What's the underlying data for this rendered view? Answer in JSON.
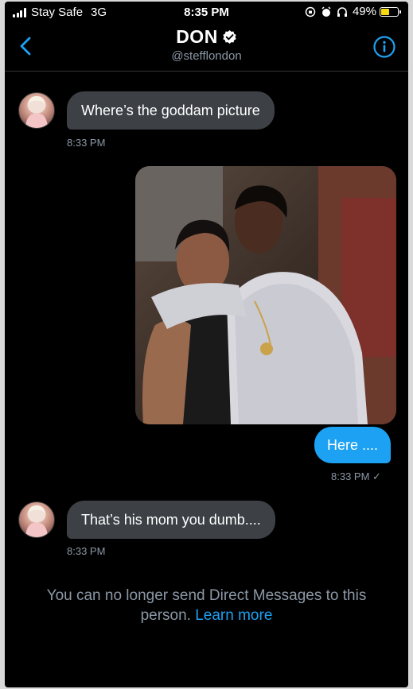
{
  "status_bar": {
    "carrier": "Stay Safe",
    "network": "3G",
    "time": "8:35 PM",
    "battery": "49%",
    "battery_level": 0.49,
    "battery_color": "#f5d90a"
  },
  "header": {
    "title": "DON",
    "handle": "@stefflondon",
    "back_icon": "chevron-left-icon",
    "info_icon": "info-circle-icon",
    "verified_icon": "verified-badge-icon"
  },
  "messages": [
    {
      "direction": "incoming",
      "text": "Where’s the goddam picture",
      "time": "8:33 PM"
    },
    {
      "direction": "outgoing",
      "type": "image",
      "text": "Here ....",
      "time": "8:33 PM ✓"
    },
    {
      "direction": "incoming",
      "text": "That’s his mom you dumb....",
      "time": "8:33 PM"
    }
  ],
  "notice": {
    "text": "You can no longer send Direct Messages to this person.",
    "link": "Learn more"
  },
  "colors": {
    "background": "#000000",
    "accent": "#1da1f2",
    "incoming_bubble": "#3d4146",
    "muted_text": "#8b98a5"
  }
}
